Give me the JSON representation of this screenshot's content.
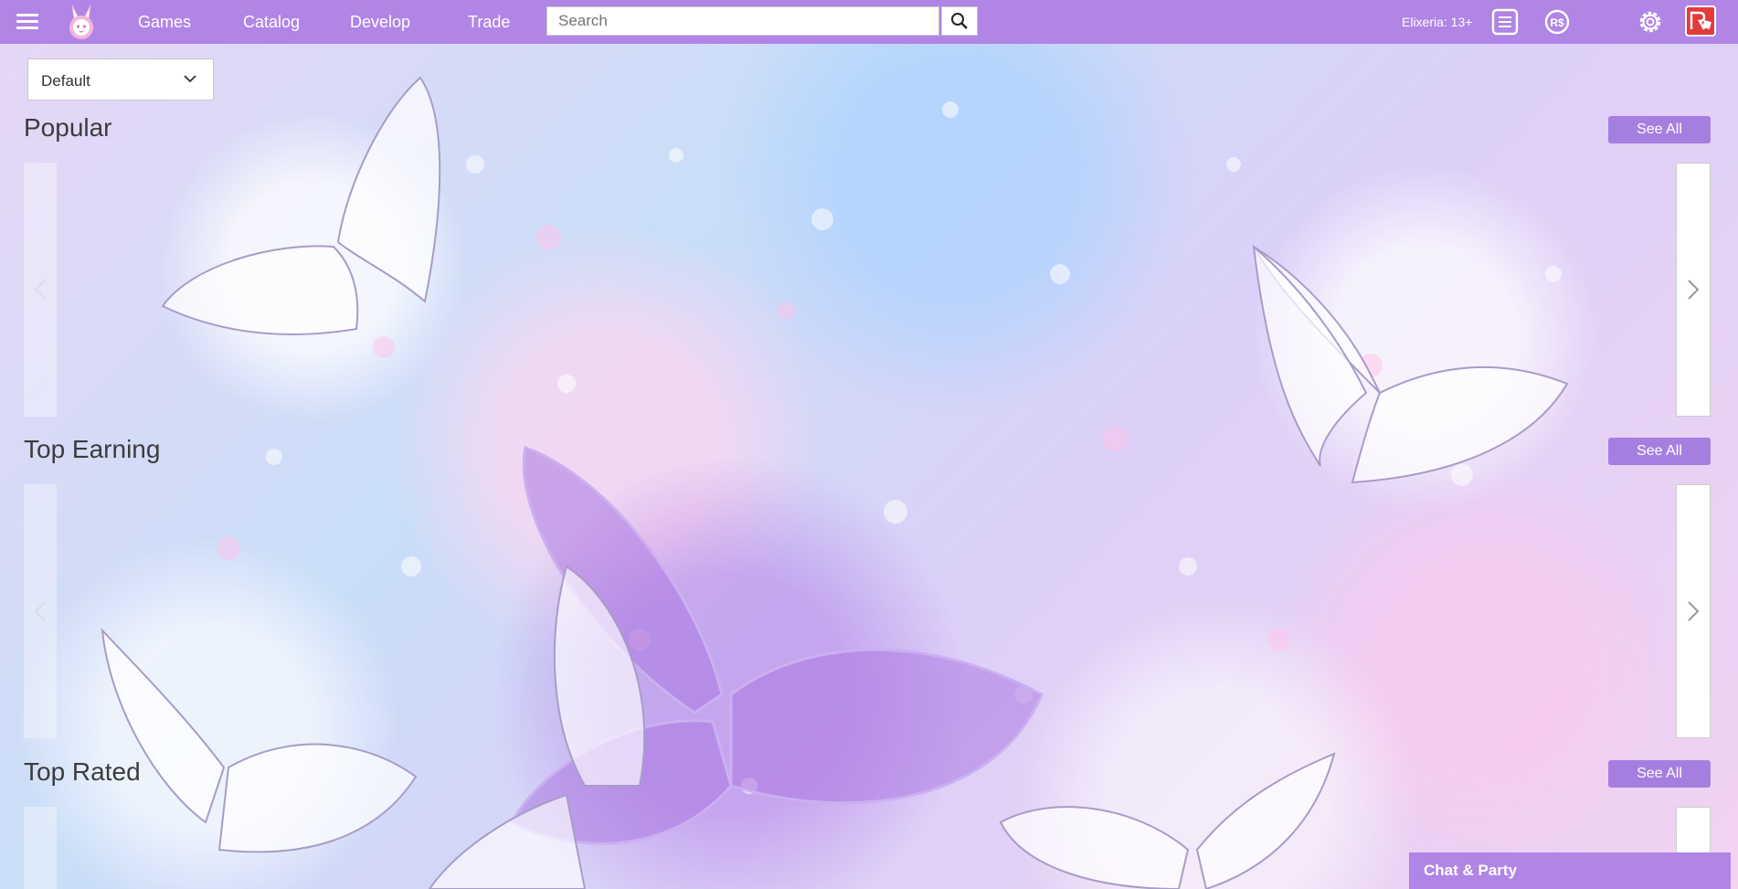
{
  "nav": {
    "links": [
      "Games",
      "Catalog",
      "Develop",
      "Trade"
    ],
    "search_placeholder": "Search",
    "user_label": "Elixeria: 13+",
    "icons": [
      "menu-icon",
      "bunny-logo-icon",
      "search-icon",
      "messages-icon",
      "robux-icon",
      "settings-icon",
      "roblox-logo-icon"
    ]
  },
  "sort": {
    "selected": "Default"
  },
  "sections": [
    {
      "title": "Popular",
      "see_all": "See All"
    },
    {
      "title": "Top Earning",
      "see_all": "See All"
    },
    {
      "title": "Top Rated",
      "see_all": "See All"
    }
  ],
  "chat": {
    "label": "Chat & Party"
  },
  "colors": {
    "accent": "#b085e6",
    "button": "#a57fe0"
  }
}
